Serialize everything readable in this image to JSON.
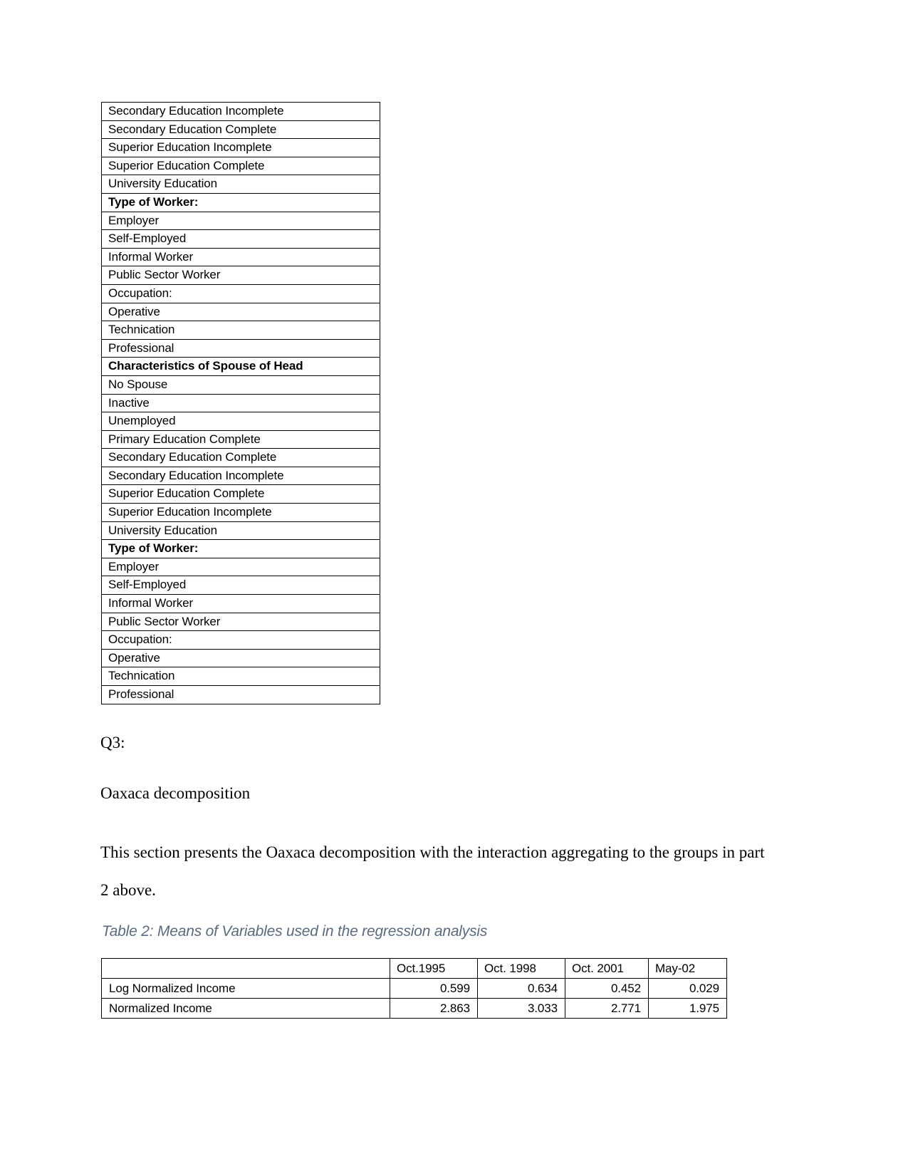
{
  "variable_table": {
    "rows": [
      {
        "label": "Secondary Education Incomplete",
        "bold": false
      },
      {
        "label": "Secondary Education Complete",
        "bold": false
      },
      {
        "label": "Superior Education Incomplete",
        "bold": false
      },
      {
        "label": "Superior Education Complete",
        "bold": false
      },
      {
        "label": "University Education",
        "bold": false
      },
      {
        "label": "Type of Worker:",
        "bold": true
      },
      {
        "label": "Employer",
        "bold": false
      },
      {
        "label": "Self-Employed",
        "bold": false
      },
      {
        "label": "Informal Worker",
        "bold": false
      },
      {
        "label": "Public Sector Worker",
        "bold": false
      },
      {
        "label": "Occupation:",
        "bold": false
      },
      {
        "label": "Operative",
        "bold": false
      },
      {
        "label": "Technication",
        "bold": false
      },
      {
        "label": "Professional",
        "bold": false
      },
      {
        "label": "Characteristics of Spouse of Head",
        "bold": true
      },
      {
        "label": "No Spouse",
        "bold": false
      },
      {
        "label": "Inactive",
        "bold": false
      },
      {
        "label": "Unemployed",
        "bold": false
      },
      {
        "label": "Primary Education Complete",
        "bold": false
      },
      {
        "label": "Secondary Education Complete",
        "bold": false
      },
      {
        "label": "Secondary Education Incomplete",
        "bold": false
      },
      {
        "label": "Superior Education Complete",
        "bold": false
      },
      {
        "label": "Superior Education Incomplete",
        "bold": false
      },
      {
        "label": "University Education",
        "bold": false
      },
      {
        "label": "Type of Worker:",
        "bold": true
      },
      {
        "label": "Employer",
        "bold": false
      },
      {
        "label": "Self-Employed",
        "bold": false
      },
      {
        "label": "Informal Worker",
        "bold": false
      },
      {
        "label": "Public Sector Worker",
        "bold": false
      },
      {
        "label": "Occupation:",
        "bold": false
      },
      {
        "label": "Operative",
        "bold": false
      },
      {
        "label": "Technication",
        "bold": false
      },
      {
        "label": "Professional",
        "bold": false
      }
    ]
  },
  "body": {
    "q3_label": "Q3:",
    "section_heading": "Oaxaca decomposition",
    "intro_paragraph": "This section presents the Oaxaca decomposition with the interaction aggregating to the groups in part 2 above."
  },
  "caption": {
    "text": "Table 2: Means of Variables used in the regression analysis",
    "color": "#5a6a80"
  },
  "means_table": {
    "corner_header": "",
    "columns": [
      "Oct.1995",
      "Oct. 1998",
      "Oct. 2001",
      "May-02"
    ],
    "rows": [
      {
        "label": "Log Normalized Income",
        "values": [
          "0.599",
          "0.634",
          "0.452",
          "0.029"
        ]
      },
      {
        "label": "Normalized Income",
        "values": [
          "2.863",
          "3.033",
          "2.771",
          "1.975"
        ]
      }
    ]
  }
}
